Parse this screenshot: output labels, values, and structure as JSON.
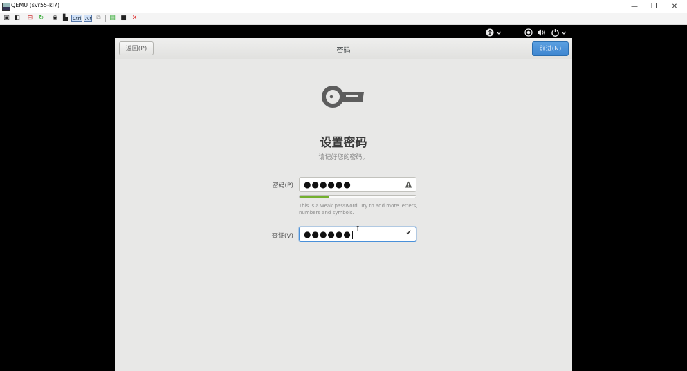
{
  "window": {
    "title": "QEMU (svr55-kl7)",
    "minimize": "—",
    "restore": "❐",
    "close": "✕"
  },
  "toolbar": {
    "ctrl_label": "Ctrl",
    "alt_label": "Alt"
  },
  "topbar": {
    "accessibility_icon": "accessibility-icon",
    "network_icon": "network-icon",
    "volume_icon": "volume-icon",
    "power_icon": "power-icon"
  },
  "header": {
    "back_label": "返回(P)",
    "title": "密码",
    "next_label": "前进(N)"
  },
  "page": {
    "title": "设置密码",
    "subtitle": "请记好您的密码。"
  },
  "form": {
    "password_label": "密码(P)",
    "password_value": "●●●●●●",
    "strength_fraction": 0.25,
    "hint": "This is a weak password. Try to add more letters, numbers and symbols.",
    "verify_label": "查证(V)",
    "verify_value": "●●●●●●"
  },
  "colors": {
    "accent": "#4a90d9",
    "strength_weak": "#73b02f",
    "warning": "#555753"
  }
}
